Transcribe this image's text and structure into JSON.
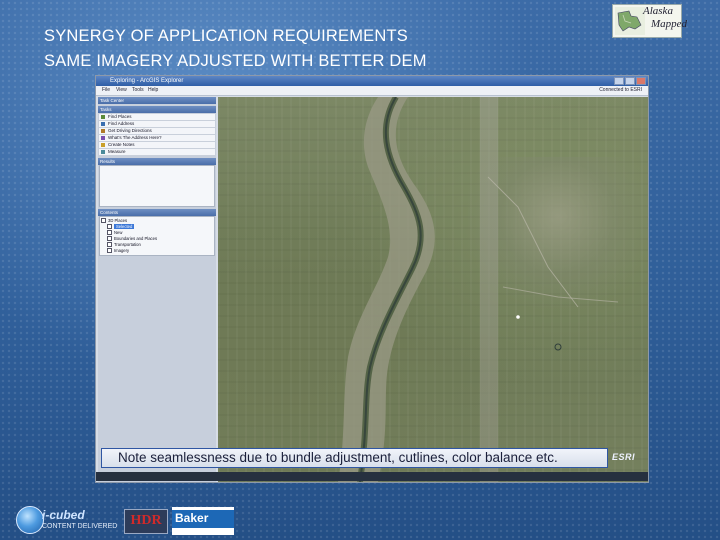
{
  "slide": {
    "title_line1": "SYNERGY OF APPLICATION REQUIREMENTS",
    "title_line2": "SAME IMAGERY ADJUSTED WITH BETTER DEM",
    "logo_alaska_line1": "Alaska",
    "logo_alaska_line2": "Mapped",
    "caption": "Note seamlessness due to bundle adjustment, cutlines, color balance etc.",
    "esri_mark": "ESRI",
    "footer": {
      "icubed_name": "i-cubed",
      "icubed_tagline": "CONTENT DELIVERED",
      "hdr": "HDR",
      "baker": "Baker"
    }
  },
  "app": {
    "window_title": "Exploring - ArcGIS Explorer",
    "menu": [
      "File",
      "View",
      "Tools",
      "Help"
    ],
    "connected": "Connected to ESRI",
    "panels": {
      "task_center": "Task Center",
      "tasks": "Tasks",
      "results": "Results",
      "contents": "Contents"
    },
    "tasks": [
      "Find Places",
      "Find Address",
      "Get Driving Directions",
      "What's The Address Here?",
      "Create Notes",
      "Measure"
    ],
    "contents": [
      {
        "label": "3D Places",
        "selected": false
      },
      {
        "label": "Selected",
        "selected": true
      },
      {
        "label": "New",
        "selected": false
      },
      {
        "label": "Boundaries and Places",
        "selected": false
      },
      {
        "label": "Transportation",
        "selected": false
      },
      {
        "label": "Imagery",
        "selected": false
      }
    ]
  },
  "colors": {
    "slide_bg": "#2c5a93",
    "caption_border": "#2f56a3",
    "selection": "#3c78d8"
  }
}
